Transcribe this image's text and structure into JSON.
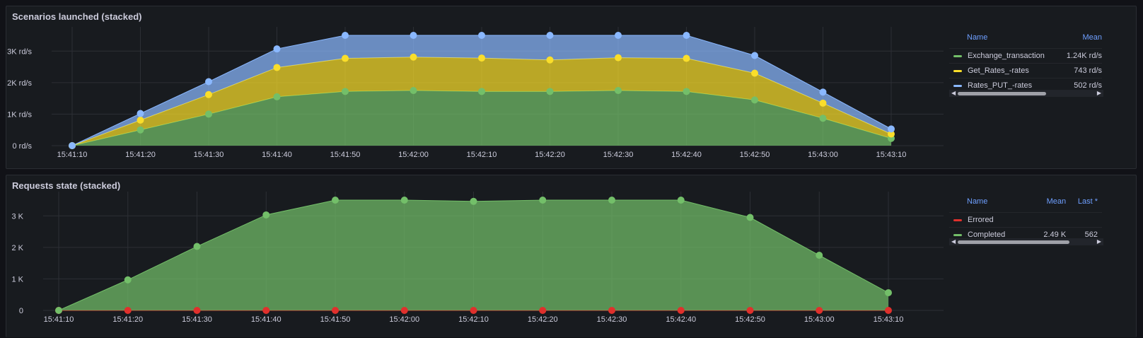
{
  "colors": {
    "green": "#73bf69",
    "yellow": "#fade2a",
    "blue": "#8ab8ff",
    "red": "#f2495c",
    "grid": "#2c2f35"
  },
  "panel1": {
    "title": "Scenarios launched (stacked)",
    "legend": {
      "headers": [
        "Name",
        "Mean"
      ],
      "rows": [
        {
          "name": "Exchange_transaction",
          "mean": "1.24K rd/s",
          "color": "#73bf69"
        },
        {
          "name": "Get_Rates_-rates",
          "mean": "743 rd/s",
          "color": "#fade2a"
        },
        {
          "name": "Rates_PUT_-rates",
          "mean": "502 rd/s",
          "color": "#8ab8ff"
        }
      ]
    }
  },
  "panel2": {
    "title": "Requests state (stacked)",
    "legend": {
      "headers": [
        "Name",
        "Mean",
        "Last *"
      ],
      "rows": [
        {
          "name": "Errored",
          "mean": "",
          "last": "",
          "color": "#e0302c"
        },
        {
          "name": "Completed",
          "mean": "2.49 K",
          "last": "562",
          "color": "#73bf69"
        }
      ]
    }
  },
  "chart_data": [
    {
      "type": "area",
      "stacked": true,
      "title": "Scenarios launched (stacked)",
      "x": [
        "15:41:10",
        "15:41:20",
        "15:41:30",
        "15:41:40",
        "15:41:50",
        "15:42:00",
        "15:42:10",
        "15:42:20",
        "15:42:30",
        "15:42:40",
        "15:42:50",
        "15:43:00",
        "15:43:10"
      ],
      "y_ticks": [
        "0 rd/s",
        "1K rd/s",
        "2K rd/s",
        "3K rd/s"
      ],
      "ylim": [
        0,
        3500
      ],
      "grid": true,
      "legend_position": "right",
      "series": [
        {
          "name": "Exchange_transaction",
          "color": "#73bf69",
          "values": [
            0,
            500,
            1000,
            1550,
            1720,
            1750,
            1720,
            1720,
            1750,
            1720,
            1450,
            870,
            230
          ]
        },
        {
          "name": "Get_Rates_-rates",
          "color": "#fade2a",
          "values": [
            0,
            310,
            620,
            930,
            1050,
            1060,
            1060,
            1000,
            1040,
            1050,
            850,
            480,
            140
          ]
        },
        {
          "name": "Rates_PUT_-rates",
          "color": "#8ab8ff",
          "values": [
            0,
            210,
            410,
            590,
            730,
            690,
            720,
            780,
            710,
            730,
            560,
            350,
            160
          ]
        }
      ]
    },
    {
      "type": "area",
      "stacked": true,
      "title": "Requests state (stacked)",
      "x": [
        "15:41:10",
        "15:41:20",
        "15:41:30",
        "15:41:40",
        "15:41:50",
        "15:42:00",
        "15:42:10",
        "15:42:20",
        "15:42:30",
        "15:42:40",
        "15:42:50",
        "15:43:00",
        "15:43:10"
      ],
      "y_ticks": [
        "0",
        "1 K",
        "2 K",
        "3 K"
      ],
      "ylim": [
        0,
        3500
      ],
      "grid": true,
      "legend_position": "right",
      "series": [
        {
          "name": "Errored",
          "color": "#e0302c",
          "values": [
            0,
            0,
            0,
            0,
            0,
            0,
            0,
            0,
            0,
            0,
            0,
            0,
            0
          ]
        },
        {
          "name": "Completed",
          "color": "#73bf69",
          "values": [
            0,
            970,
            2030,
            3030,
            3500,
            3500,
            3460,
            3500,
            3500,
            3500,
            2950,
            1750,
            562
          ]
        }
      ]
    }
  ]
}
